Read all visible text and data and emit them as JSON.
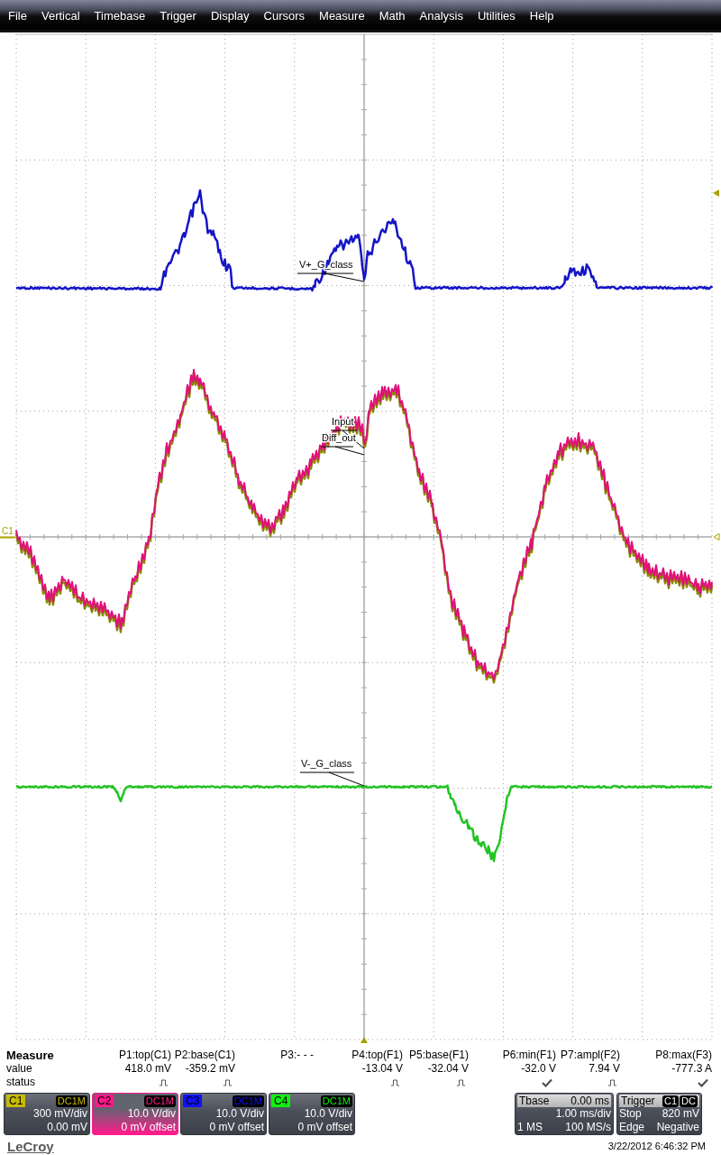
{
  "menu": [
    "File",
    "Vertical",
    "Timebase",
    "Trigger",
    "Display",
    "Cursors",
    "Measure",
    "Math",
    "Analysis",
    "Utilities",
    "Help"
  ],
  "display": {
    "offset_marker": "C1",
    "traces": [
      {
        "kind": "pulse",
        "label": "V+_G_class",
        "color": "#1414c8"
      },
      {
        "kind": "envelope",
        "label": "Input",
        "color": "#8a8a00"
      },
      {
        "kind": "wave",
        "label": "Diff_out",
        "color": "#e0107a"
      },
      {
        "kind": "dip",
        "label": "V-_G_class",
        "color": "#22c422"
      }
    ]
  },
  "measure": {
    "title": "Measure",
    "row_labels": [
      "value",
      "status"
    ],
    "params": [
      {
        "name": "P1:top(C1)",
        "value": "418.0 mV",
        "kind": "pulse"
      },
      {
        "name": "P2:base(C1)",
        "value": "-359.2 mV",
        "kind": "pulse"
      },
      {
        "name": "P3:- - -",
        "kind": "none"
      },
      {
        "name": "P4:top(F1)",
        "value": "-13.04 V",
        "kind": "pulse"
      },
      {
        "name": "P5:base(F1)",
        "value": "-32.04 V",
        "kind": "pulse"
      },
      {
        "name": "P6:min(F1)",
        "value": "-32.0 V",
        "kind": "check"
      },
      {
        "name": "P7:ampl(F2)",
        "value": "7.94 V",
        "kind": "pulse"
      },
      {
        "name": "P8:max(F3)",
        "value": "-777.3 A",
        "kind": "check"
      }
    ]
  },
  "channels": [
    {
      "name": "C1",
      "coupling": "DC1M",
      "color": "#c8bc00",
      "scale": "300 mV/div",
      "offset": "0.00 mV",
      "selected": false
    },
    {
      "name": "C2",
      "coupling": "DC1M",
      "color": "#ff1a8c",
      "scale": "10.0 V/div",
      "offset": "0 mV offset",
      "selected": true
    },
    {
      "name": "C3",
      "coupling": "DC1M",
      "color": "#1010ff",
      "scale": "10.0 V/div",
      "offset": "0 mV offset",
      "selected": false
    },
    {
      "name": "C4",
      "coupling": "DC1M",
      "color": "#10f010",
      "scale": "10.0 V/div",
      "offset": "0 mV offset",
      "selected": false
    }
  ],
  "timebase": {
    "title": "Tbase",
    "delay": "0.00 ms",
    "scale": "1.00 ms/div",
    "samples": "1 MS",
    "rate": "100 MS/s"
  },
  "trigger": {
    "title": "Trigger",
    "source": "C1",
    "coupling": "DC",
    "mode": "Stop",
    "trigger_level": "820 mV",
    "type": "Edge",
    "slope": "Negative"
  },
  "footer": {
    "brand": "LeCroy",
    "timestamp": "3/22/2012 6:46:32 PM"
  }
}
